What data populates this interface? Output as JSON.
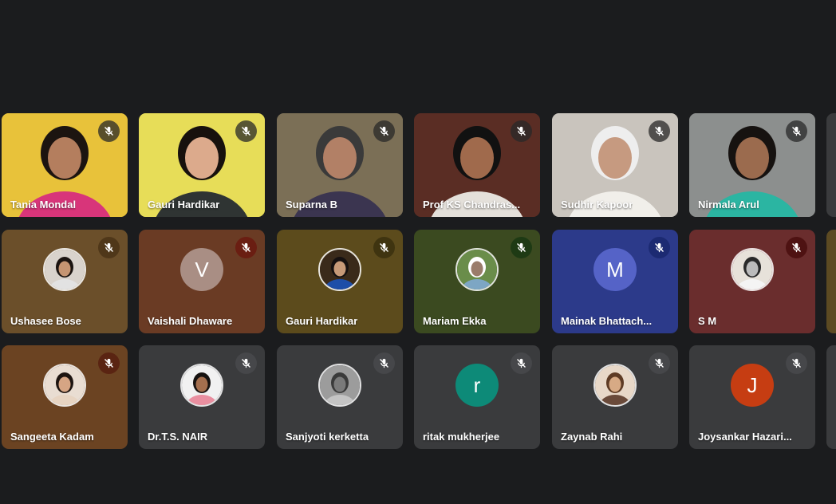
{
  "participants": [
    {
      "name": "Tania Mondal",
      "mic": "muted",
      "kind": "video",
      "bg": "#e8c23a",
      "skin": "#b47e5e",
      "hair": "#1c1410",
      "shirt": "#d8357a"
    },
    {
      "name": "Gauri Hardikar",
      "mic": "muted",
      "kind": "video",
      "bg": "#e7dd58",
      "skin": "#dcaa8c",
      "hair": "#17110d",
      "shirt": "#2f3433"
    },
    {
      "name": "Suparna B",
      "mic": "muted",
      "kind": "video",
      "bg": "#7b6f56",
      "skin": "#b28066",
      "hair": "#3a3a3a",
      "shirt": "#3b3550"
    },
    {
      "name": "Prof KS Chandras...",
      "mic": "muted",
      "kind": "video",
      "bg": "#5a2d24",
      "skin": "#a06a4c",
      "hair": "#111111",
      "shirt": "#e4e0da"
    },
    {
      "name": "Sudhir Kapoor",
      "mic": "muted",
      "kind": "video",
      "bg": "#c9c4bd",
      "skin": "#c69a80",
      "hair": "#eeeeee",
      "shirt": "#f1efea"
    },
    {
      "name": "Nirmala Arul",
      "mic": "muted",
      "kind": "video",
      "bg": "#8c8f8e",
      "skin": "#9b6b4e",
      "hair": "#161210",
      "shirt": "#2bb5a2"
    },
    {
      "name": "Ushasee Bose",
      "mic": "muted",
      "kind": "photo",
      "bg": "#6b4f2a",
      "micbg": "#4f3719",
      "avbg": "#d9d3cc",
      "skin": "#c59572",
      "hair": "#1b1410",
      "shirt": "#e2e2e2"
    },
    {
      "name": "Vaishali Dhaware",
      "mic": "muted",
      "kind": "letter",
      "letter": "V",
      "bg": "#6a3b24",
      "micbg": "#6a1e12",
      "avbg": "#a98e84"
    },
    {
      "name": "Gauri Hardikar",
      "mic": "muted",
      "kind": "photo",
      "bg": "#5c4b1c",
      "micbg": "#3f3410",
      "avbg": "#3a2a1a",
      "skin": "#c79a78",
      "hair": "#151010",
      "shirt": "#1d4ea8"
    },
    {
      "name": "Mariam Ekka",
      "mic": "muted",
      "kind": "photo",
      "bg": "#3b4a20",
      "micbg": "#1e3a14",
      "avbg": "#6a8d4a",
      "skin": "#9a7c6a",
      "hair": "#ffffff",
      "shirt": "#7da6c4"
    },
    {
      "name": "Mainak Bhattach...",
      "mic": "muted",
      "kind": "letter",
      "letter": "M",
      "bg": "#2c3a8a",
      "micbg": "#1c2a72",
      "avbg": "#5563c7"
    },
    {
      "name": "S M",
      "mic": "muted",
      "kind": "photo",
      "bg": "#6a2d2d",
      "micbg": "#4e1212",
      "avbg": "#e7e2da",
      "skin": "#bbb",
      "hair": "#2a2a2a",
      "shirt": "#f4f4f4"
    },
    {
      "name": "Sangeeta Kadam",
      "mic": "muted",
      "kind": "photo",
      "bg": "#6b4322",
      "micbg": "#5a2412",
      "avbg": "#e9ddd2",
      "skin": "#d6a584",
      "hair": "#1d1410",
      "shirt": "#e7d4c2"
    },
    {
      "name": "Dr.T.S. NAIR",
      "mic": "muted",
      "kind": "photo",
      "bg": "#3a3b3d",
      "micbg": "#46474a",
      "avbg": "#f1f1f1",
      "skin": "#a46f4e",
      "hair": "#161210",
      "shirt": "#e98fa0"
    },
    {
      "name": "Sanjyoti kerketta",
      "mic": "muted",
      "kind": "photo",
      "bg": "#3a3b3d",
      "micbg": "#46474a",
      "avbg": "#9c9c9c",
      "skin": "#7a7a7a",
      "hair": "#3a3a3a",
      "shirt": "#c4c4c4"
    },
    {
      "name": "ritak mukherjee",
      "mic": "muted",
      "kind": "letter",
      "letter": "r",
      "bg": "#3a3b3d",
      "micbg": "#46474a",
      "avbg": "#0d8a78"
    },
    {
      "name": "Zaynab Rahi",
      "mic": "muted",
      "kind": "photo",
      "bg": "#3a3b3d",
      "micbg": "#46474a",
      "avbg": "#e8d8c8",
      "skin": "#d7aa85",
      "hair": "#5e3b24",
      "shirt": "#6a4a3a"
    },
    {
      "name": "Joysankar Hazari...",
      "mic": "muted",
      "kind": "letter",
      "letter": "J",
      "bg": "#3a3b3d",
      "micbg": "#46474a",
      "avbg": "#c63d12"
    }
  ],
  "partial_tiles": [
    {
      "bg": "#3a3b3d"
    },
    {
      "bg": "#5c4a22"
    },
    {
      "bg": "#3a3b3d"
    }
  ],
  "colors": {
    "page_bg": "#1b1c1e",
    "video_mic_bg": "rgba(40,40,40,0.75)"
  },
  "icons": {
    "mic": "mic-off-icon"
  }
}
